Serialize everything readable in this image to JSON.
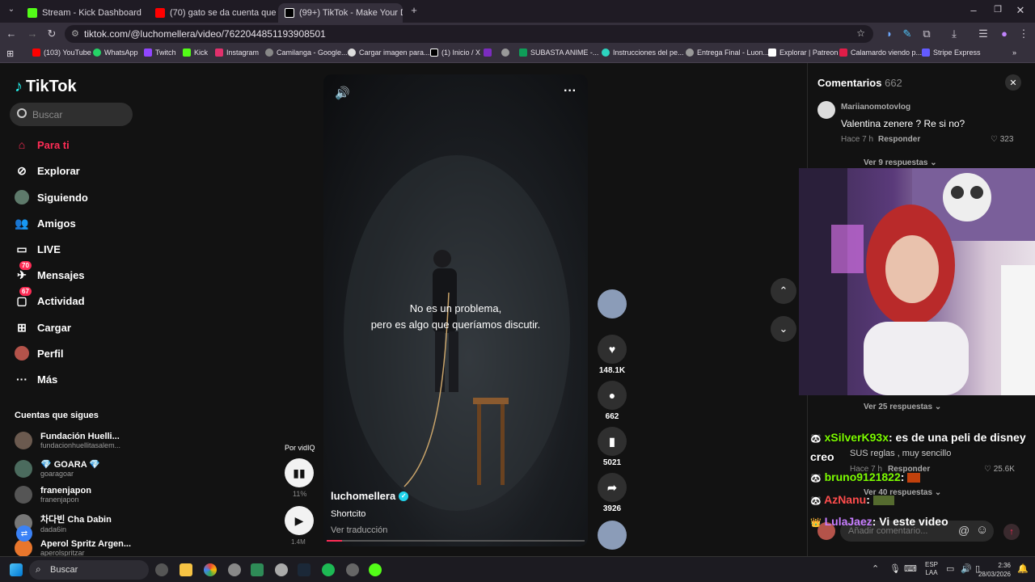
{
  "browser": {
    "tabs": [
      {
        "title": "Stream - Kick Dashboard",
        "color": "#53fc18"
      },
      {
        "title": "(70) gato se da cuenta que lo g",
        "color": "#ff0000"
      },
      {
        "title": "(99+) TikTok - Make Your D",
        "color": "#000000"
      }
    ],
    "url": "tiktok.com/@luchomellera/video/7622044851193908501",
    "bookmarks": [
      {
        "label": "(103) YouTube",
        "color": "#ff0000"
      },
      {
        "label": "WhatsApp",
        "color": "#25d366"
      },
      {
        "label": "Twitch",
        "color": "#9146ff"
      },
      {
        "label": "Kick",
        "color": "#53fc18"
      },
      {
        "label": "Instagram",
        "color": "#e1306c"
      },
      {
        "label": "Camilanga - Google...",
        "color": "#888888"
      },
      {
        "label": "Cargar imagen para...",
        "color": "#dddddd"
      },
      {
        "label": "(1) Inicio / X",
        "color": "#000000"
      },
      {
        "label": "",
        "color": "#7b2cbf"
      },
      {
        "label": "",
        "color": "#999999"
      },
      {
        "label": "SUBASTA ANIME -...",
        "color": "#0f9d58"
      },
      {
        "label": "Instrucciones del pe...",
        "color": "#2dd4bf"
      },
      {
        "label": "Entrega Final - Luon...",
        "color": "#999999"
      },
      {
        "label": "Explorar | Patreon",
        "color": "#ffffff"
      },
      {
        "label": "Calamardo viendo p...",
        "color": "#e11d48"
      },
      {
        "label": "Stripe Express",
        "color": "#635bff"
      }
    ]
  },
  "tiktok": {
    "logo": "TikTok",
    "search_placeholder": "Buscar",
    "nav": [
      {
        "label": "Para ti",
        "icon": "home-icon"
      },
      {
        "label": "Explorar",
        "icon": "compass-icon"
      },
      {
        "label": "Siguiendo",
        "icon": "avatar-icon"
      },
      {
        "label": "Amigos",
        "icon": "friends-icon"
      },
      {
        "label": "LIVE",
        "icon": "live-icon"
      },
      {
        "label": "Mensajes",
        "icon": "message-icon",
        "badge": "70"
      },
      {
        "label": "Actividad",
        "icon": "activity-icon",
        "badge": "67"
      },
      {
        "label": "Cargar",
        "icon": "upload-icon"
      },
      {
        "label": "Perfil",
        "icon": "profile-icon"
      },
      {
        "label": "Más",
        "icon": "more-icon"
      }
    ],
    "following_title": "Cuentas que sigues",
    "following": [
      {
        "name": "Fundación Huelli...",
        "handle": "fundacionhuellitasalem..."
      },
      {
        "name": "💎 GOARA 💎",
        "handle": "goaragoar"
      },
      {
        "name": "franenjapon",
        "handle": "franenjapon"
      },
      {
        "name": "차다빈 Cha Dabin",
        "handle": "dada6in"
      },
      {
        "name": "Aperol Spritz Argen...",
        "handle": "aperolspritzar"
      }
    ],
    "video": {
      "subtitle_1": "No es un problema,",
      "subtitle_2": "pero es algo que queríamos discutir.",
      "author": "luchomellera",
      "caption": "Shortcito",
      "translate": "Ver traducción",
      "vidiq_label": "Por vidIQ",
      "vidiq_pct": "11%",
      "views": "1.4M"
    },
    "actions": {
      "likes": "148.1K",
      "comments": "662",
      "saves": "5021",
      "shares": "3926"
    },
    "comments": {
      "title": "Comentarios",
      "count": "662",
      "first": {
        "user": "Mariianomotovlog",
        "text": "Valentina zenere ? Re si no?",
        "time": "Hace 7 h",
        "reply": "Responder",
        "likes": "323",
        "more": "Ver 9 respuestas"
      },
      "more_25": "Ver 25 respuestas",
      "second": {
        "text": "SUS reglas , muy sencillo",
        "time": "Hace 7 h",
        "reply": "Responder",
        "likes": "25.6K"
      },
      "more_40": "Ver 40 respuestas",
      "add_placeholder": "Añadir comentario..."
    }
  },
  "stream_chat": [
    {
      "user": "xSilverK93x",
      "text": ": es de una peli de disney creo",
      "color": "#7cfc00"
    },
    {
      "user": "bruno9121822",
      "text": ":",
      "color": "#7cfc00"
    },
    {
      "user": "AzNanu",
      "text": ":",
      "color": "#ff4d4d"
    },
    {
      "user": "LulaJaez",
      "text": ": Vi este video",
      "color": "#c77dff"
    }
  ],
  "taskbar": {
    "search": "Buscar",
    "lang": "ESP",
    "lang2": "LAA",
    "time": "2:36",
    "date": "28/03/2026"
  }
}
